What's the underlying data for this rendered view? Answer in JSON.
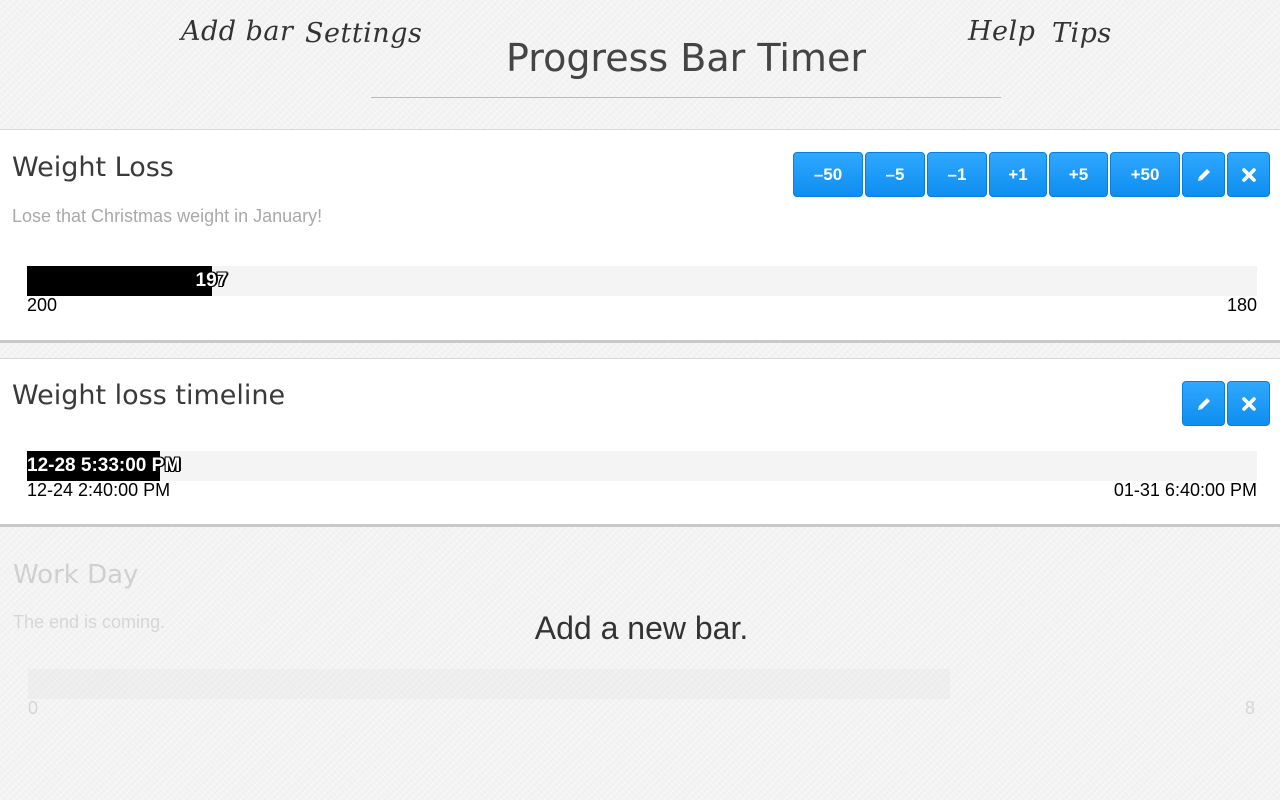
{
  "header": {
    "title": "Progress Bar Timer",
    "nav_left": [
      "Add bar",
      "Settings"
    ],
    "nav_right": [
      "Help",
      "Tips"
    ]
  },
  "bars": [
    {
      "title": "Weight Loss",
      "description": "Lose that Christmas weight in January!",
      "buttons": [
        "–50",
        "–5",
        "–1",
        "+1",
        "+5",
        "+50"
      ],
      "icon_buttons": [
        "pencil-icon",
        "close-icon"
      ],
      "min_label": "200",
      "max_label": "180",
      "current_label": "197",
      "progress": 0.15
    },
    {
      "title": "Weight loss timeline",
      "icon_buttons": [
        "pencil-icon",
        "close-icon"
      ],
      "min_label": "12-24 2:40:00 PM",
      "max_label": "01-31 6:40:00 PM",
      "current_label": "12-28 5:33:00 PM",
      "progress": 0.108
    },
    {
      "title": "Work Day",
      "description": "The end is coming.",
      "min_label": "0",
      "max_label": "8",
      "faded": true
    }
  ],
  "overlay": {
    "add_bar_label": "Add a new bar."
  },
  "colors": {
    "button": "#1a9bf7",
    "fill": "#000000",
    "track": "#f4f4f4"
  }
}
